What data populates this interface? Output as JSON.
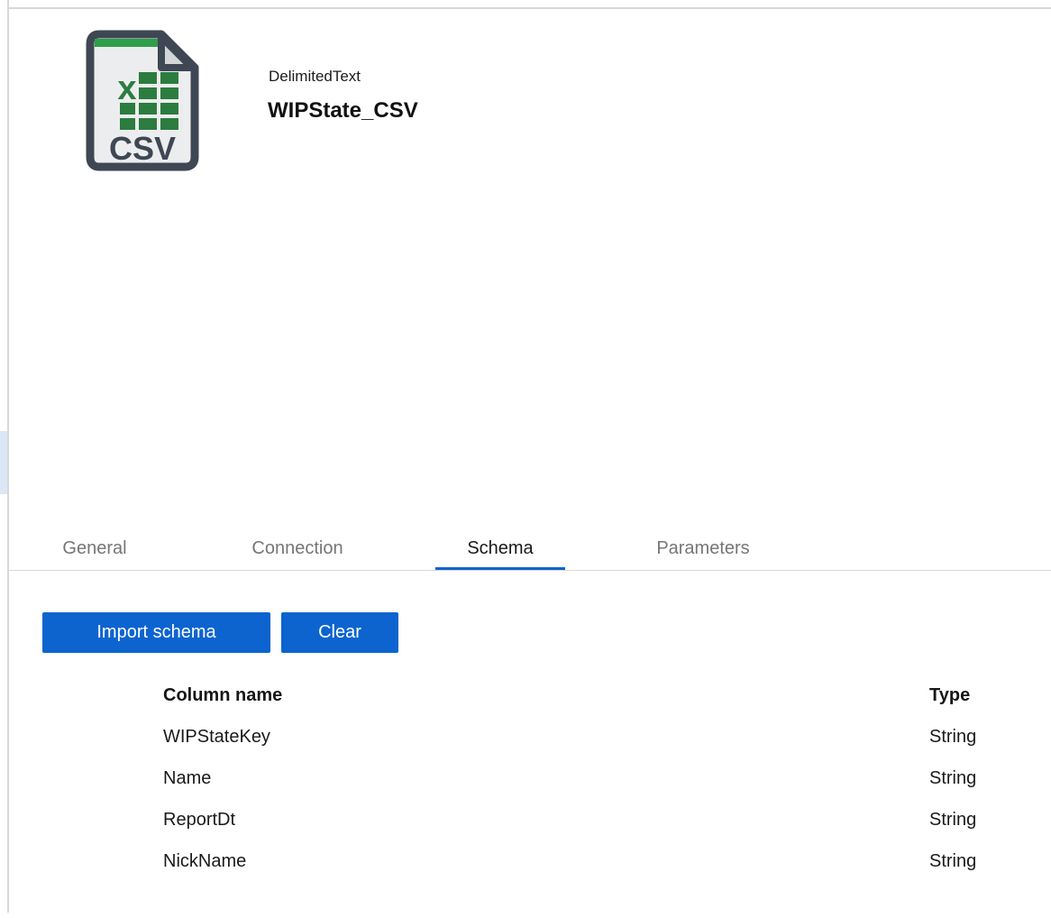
{
  "dataset": {
    "type_label": "DelimitedText",
    "name": "WIPState_CSV",
    "icon": {
      "label": "CSV",
      "x_glyph": "x"
    }
  },
  "tabs": [
    {
      "label": "General",
      "active": false
    },
    {
      "label": "Connection",
      "active": false
    },
    {
      "label": "Schema",
      "active": true
    },
    {
      "label": "Parameters",
      "active": false
    }
  ],
  "schema": {
    "import_button": "Import schema",
    "clear_button": "Clear",
    "table": {
      "headers": {
        "column": "Column name",
        "type": "Type"
      },
      "rows": [
        {
          "column": "WIPStateKey",
          "type": "String"
        },
        {
          "column": "Name",
          "type": "String"
        },
        {
          "column": "ReportDt",
          "type": "String"
        },
        {
          "column": "NickName",
          "type": "String"
        }
      ]
    }
  },
  "colors": {
    "accent": "#0d64cf",
    "tab_inactive": "#767676",
    "border": "#d8d8d8",
    "selection_blue": "#dbe7f5",
    "icon_dark": "#3e4753",
    "icon_paper": "#ecedee",
    "icon_green_grid": "#2c7c3f",
    "icon_green_stripe": "#2f9e4a"
  }
}
